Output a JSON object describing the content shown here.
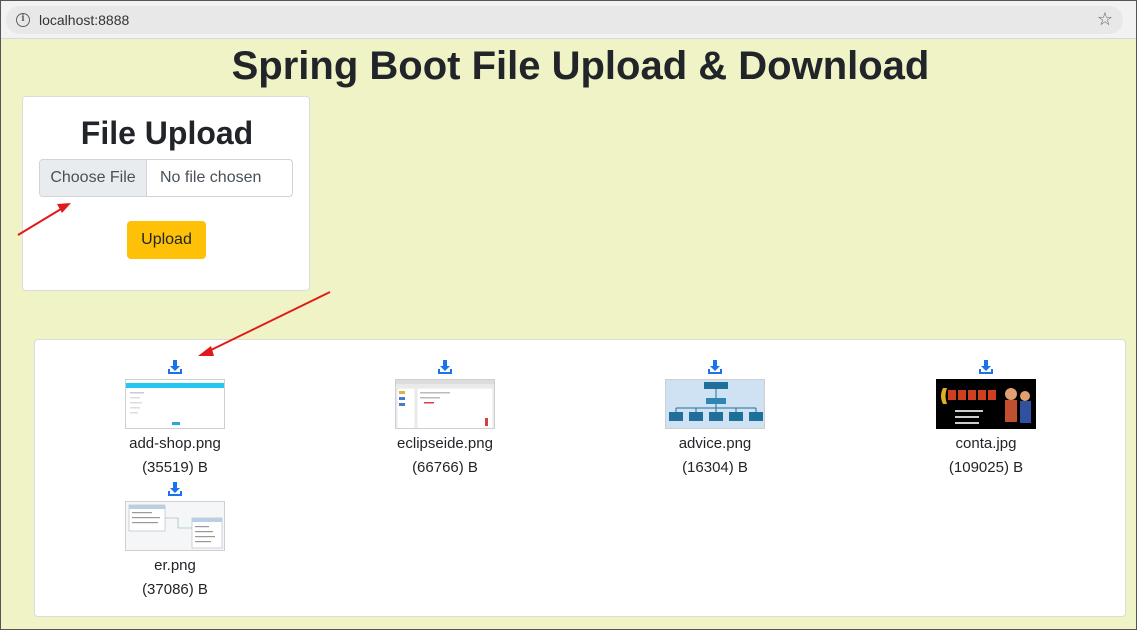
{
  "browser": {
    "url": "localhost:8888"
  },
  "page": {
    "title": "Spring Boot File Upload & Download"
  },
  "upload": {
    "title": "File Upload",
    "choose_label": "Choose File",
    "no_file_label": "No file chosen",
    "button_label": "Upload"
  },
  "colors": {
    "page_bg": "#eff3c6",
    "upload_button": "#ffc107",
    "download_icon": "#1a73e8",
    "annotation_arrow": "#e01a1a"
  },
  "files": [
    {
      "name": "add-shop.png",
      "size": "(35519) B",
      "icon": "download-icon"
    },
    {
      "name": "eclipseide.png",
      "size": "(66766) B",
      "icon": "download-icon"
    },
    {
      "name": "advice.png",
      "size": "(16304) B",
      "icon": "download-icon"
    },
    {
      "name": "conta.jpg",
      "size": "(109025) B",
      "icon": "download-icon"
    },
    {
      "name": "er.png",
      "size": "(37086) B",
      "icon": "download-icon"
    }
  ]
}
